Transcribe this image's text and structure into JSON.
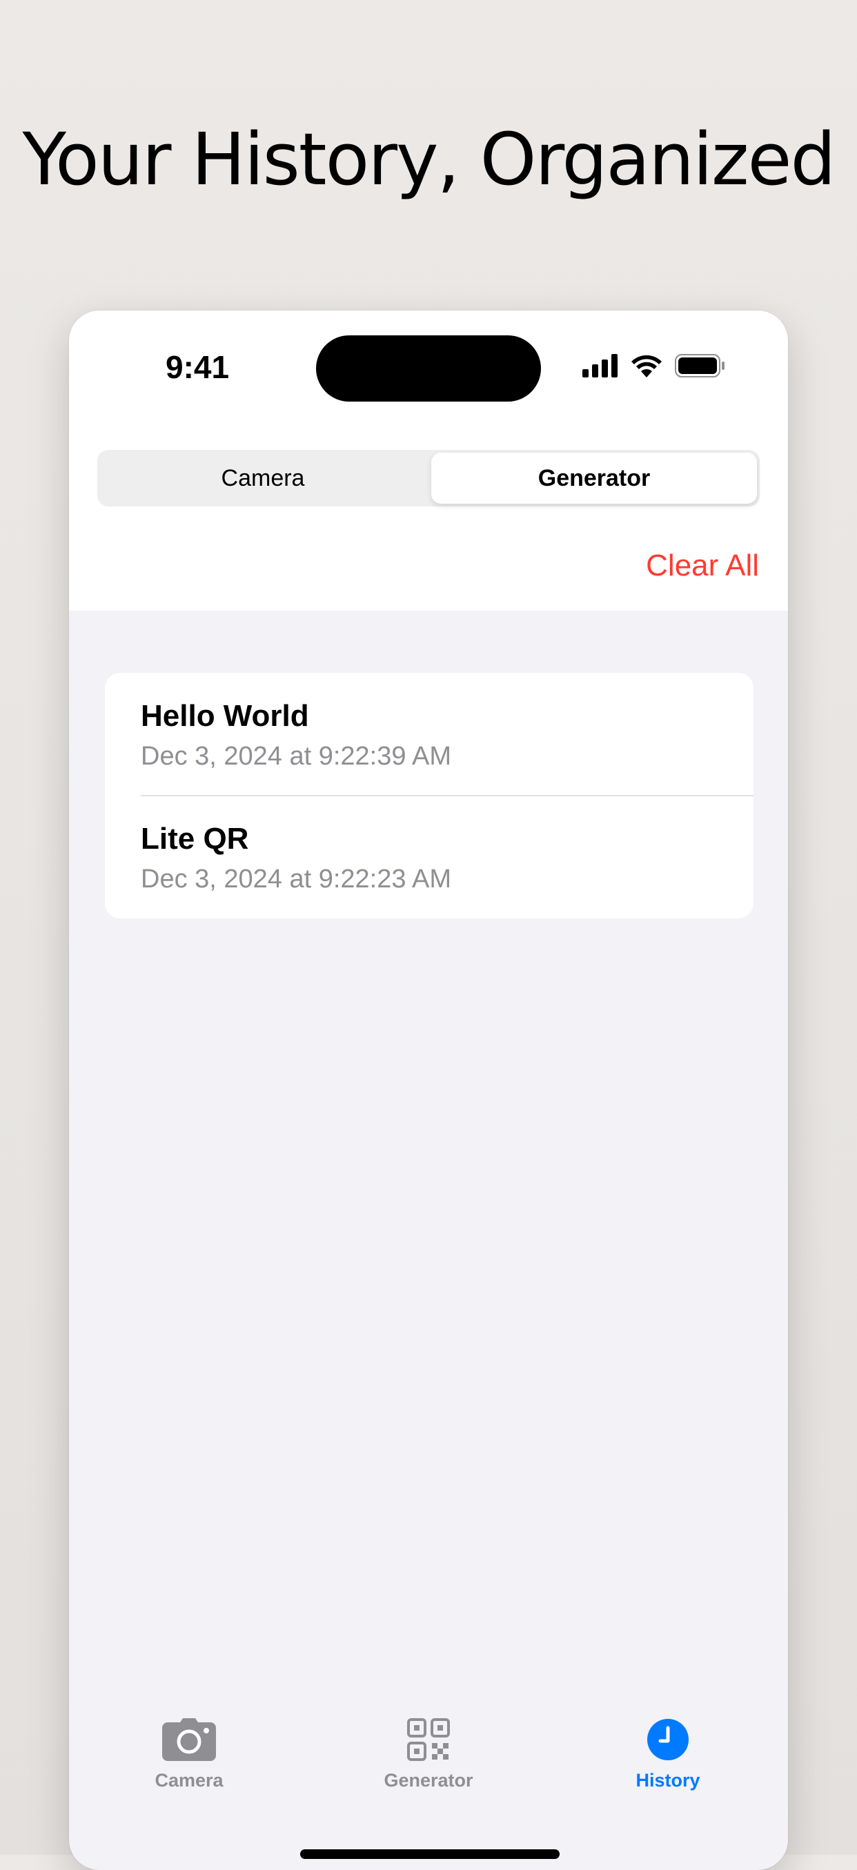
{
  "headline": "Your History, Organized",
  "status": {
    "time": "9:41"
  },
  "segmented": {
    "left": "Camera",
    "right": "Generator",
    "selected": "Generator"
  },
  "actions": {
    "clear_all": "Clear All"
  },
  "history": [
    {
      "title": "Hello World",
      "date": "Dec 3, 2024 at 9:22:39 AM"
    },
    {
      "title": "Lite QR",
      "date": "Dec 3, 2024 at 9:22:23 AM"
    }
  ],
  "tabbar": {
    "items": [
      {
        "label": "Camera",
        "icon": "camera-icon",
        "active": false
      },
      {
        "label": "Generator",
        "icon": "qr-code-icon",
        "active": false
      },
      {
        "label": "History",
        "icon": "clock-icon",
        "active": true
      }
    ]
  },
  "colors": {
    "accent": "#007aff",
    "destructive": "#ff3b30",
    "secondary_text": "#8e8e93",
    "background": "#f2f2f7"
  }
}
